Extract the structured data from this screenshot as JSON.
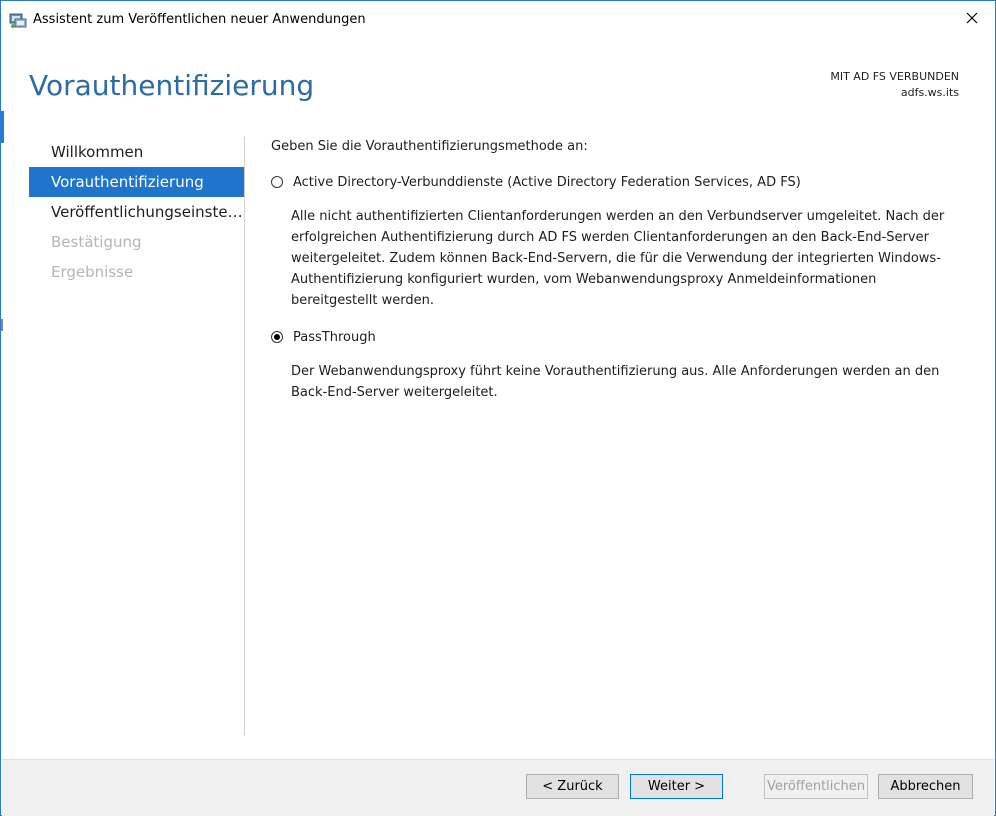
{
  "window": {
    "title": "Assistent zum Veröffentlichen neuer Anwendungen",
    "icon": "wizard-app-icon"
  },
  "header": {
    "title": "Vorauthentifizierung",
    "connection_status": "MIT AD FS VERBUNDEN",
    "server": "adfs.ws.its"
  },
  "nav": {
    "items": [
      {
        "label": "Willkommen",
        "state": "normal"
      },
      {
        "label": "Vorauthentifizierung",
        "state": "active"
      },
      {
        "label": "Veröffentlichungseinstellu...",
        "state": "normal"
      },
      {
        "label": "Bestätigung",
        "state": "disabled"
      },
      {
        "label": "Ergebnisse",
        "state": "disabled"
      }
    ]
  },
  "content": {
    "prompt": "Geben Sie die Vorauthentifizierungsmethode an:",
    "options": [
      {
        "label": "Active Directory-Verbunddienste (Active Directory Federation Services, AD FS)",
        "checked": false,
        "description": "Alle nicht authentifizierten Clientanforderungen werden an den Verbundserver umgeleitet. Nach der erfolgreichen Authentifizierung durch AD FS werden Clientanforderungen an den Back-End-Server weitergeleitet. Zudem können Back-End-Servern, die für die Verwendung der integrierten Windows-Authentifizierung konfiguriert wurden, vom Webanwendungsproxy Anmeldeinformationen bereitgestellt werden."
      },
      {
        "label": "PassThrough",
        "checked": true,
        "description": "Der Webanwendungsproxy führt keine Vorauthentifizierung aus. Alle Anforderungen werden an den Back-End-Server weitergeleitet."
      }
    ]
  },
  "footer": {
    "back_label": "< Zurück",
    "next_label": "Weiter >",
    "publish_label": "Veröffentlichen",
    "cancel_label": "Abbrechen"
  }
}
